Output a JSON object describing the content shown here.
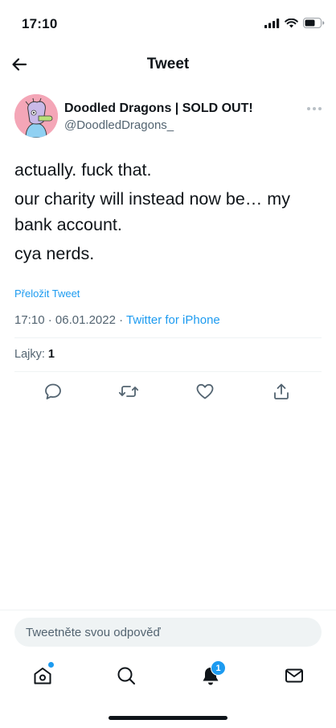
{
  "status_bar": {
    "time": "17:10"
  },
  "header": {
    "title": "Tweet"
  },
  "author": {
    "name": "Doodled Dragons | SOLD OUT!",
    "handle": "@DoodledDragons_"
  },
  "tweet": {
    "lines": [
      "actually. fuck that.",
      "our charity will instead now be… my bank account.",
      "cya nerds."
    ],
    "translate_label": "Přeložit Tweet",
    "time": "17:10",
    "date": "06.01.2022",
    "separator": "·",
    "source": "Twitter for iPhone",
    "likes_label": "Lajky:",
    "likes_count": "1"
  },
  "reply": {
    "placeholder": "Tweetněte svou odpověď"
  },
  "tab_bar": {
    "notifications_badge": "1"
  },
  "colors": {
    "accent": "#1d9bf0",
    "text": "#0f1419",
    "muted": "#536471",
    "divider": "#eff3f4"
  },
  "icons": [
    "back-arrow-icon",
    "more-icon",
    "reply-icon",
    "retweet-icon",
    "like-icon",
    "share-icon",
    "home-icon",
    "search-icon",
    "bell-icon",
    "mail-icon"
  ]
}
